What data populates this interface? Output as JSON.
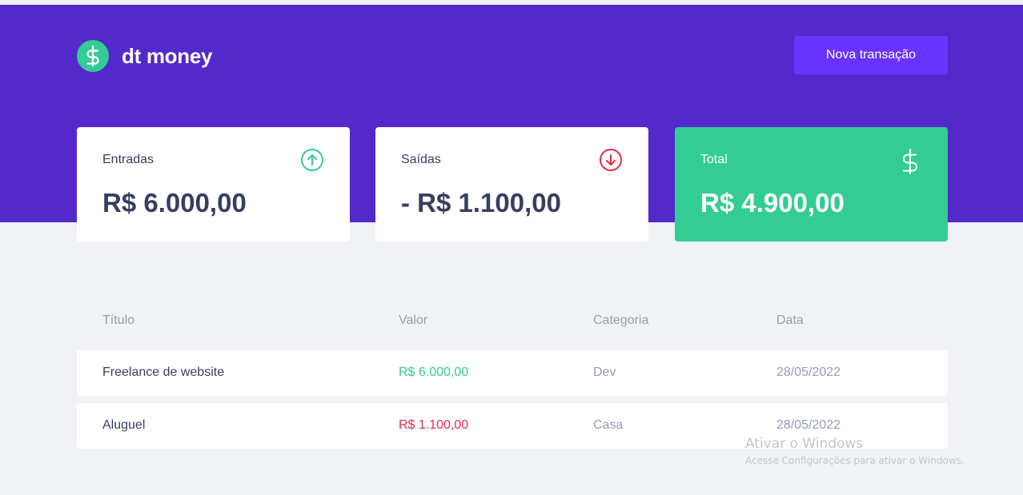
{
  "header": {
    "logo_text": "dt money",
    "new_transaction_label": "Nova transação"
  },
  "summary": {
    "income": {
      "label": "Entradas",
      "value": "R$ 6.000,00",
      "icon": "arrow-circle-up-icon",
      "icon_color": "#33CC95"
    },
    "outcome": {
      "label": "Saídas",
      "value": "- R$ 1.100,00",
      "icon": "arrow-circle-down-icon",
      "icon_color": "#E52E4D"
    },
    "total": {
      "label": "Total",
      "value": "R$ 4.900,00",
      "icon": "dollar-sign-icon",
      "background": "#33CC95"
    }
  },
  "table": {
    "columns": [
      "Título",
      "Valor",
      "Categoria",
      "Data"
    ],
    "rows": [
      {
        "title": "Freelance de website",
        "amount": "R$ 6.000,00",
        "type": "deposit",
        "category": "Dev",
        "date": "28/05/2022"
      },
      {
        "title": "Aluguel",
        "amount": "R$ 1.100,00",
        "type": "withdraw",
        "category": "Casa",
        "date": "28/05/2022"
      }
    ]
  },
  "watermark": {
    "title": "Ativar o Windows",
    "subtitle": "Acesse Configurações para ativar o Windows."
  },
  "colors": {
    "brand_purple": "#5429CC",
    "button_purple": "#6933FF",
    "green": "#33CC95",
    "red": "#E52E4D",
    "text_title": "#363F5F",
    "text_body": "#969CB3",
    "background": "#F0F2F5"
  }
}
